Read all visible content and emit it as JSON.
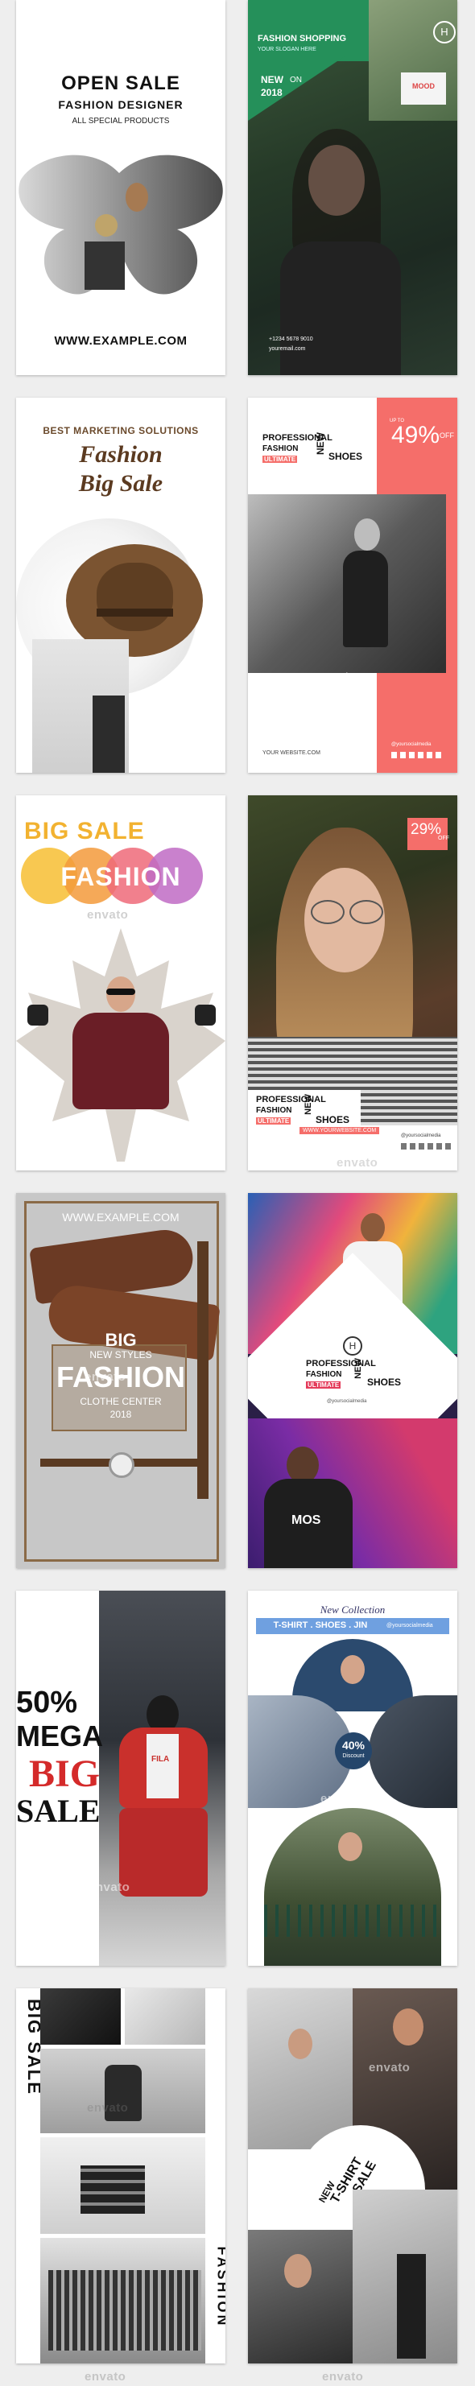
{
  "watermark": "envato",
  "t1": {
    "title": "OPEN SALE",
    "subtitle": "FASHION DESIGNER",
    "tagline": "ALL SPECIAL PRODUCTS",
    "url": "WWW.EXAMPLE.COM"
  },
  "t2": {
    "header": "FASHION SHOPPING",
    "slogan": "YOUR SLOGAN HERE",
    "new_label": "NEW",
    "on_label": "ON",
    "year": "2018",
    "logo": "H",
    "shirt_text": "MOOD",
    "contact1": "+1234 5678 9010",
    "contact2": "youremail.com"
  },
  "t3": {
    "header": "BEST MARKETING SOLUTIONS",
    "line1": "Fashion",
    "line2": "Big Sale"
  },
  "t4": {
    "professional": "PROFESSIONAL",
    "fashion": "FASHION",
    "ultimate": "ULTIMATE",
    "new_label": "NEW",
    "shoes": "SHOES",
    "upto": "UP TO",
    "percent": "49%",
    "off": "OFF",
    "website": "YOUR WEBSITE.COM",
    "social": "@yoursocialmedia"
  },
  "t5": {
    "big_sale": "BIG SALE",
    "fashion": "FASHION"
  },
  "t6": {
    "percent": "29%",
    "off": "OFF",
    "professional": "PROFESSIONAL",
    "fashion": "FASHION",
    "ultimate": "ULTIMATE",
    "new_label": "NEW",
    "shoes": "SHOES",
    "website": "WWW.YOURWEBSITE.COM",
    "social": "@yoursocialmedia"
  },
  "t7": {
    "url": "WWW.EXAMPLE.COM",
    "big": "BIG",
    "new_styles": "NEW STYLES",
    "fashion": "FASHION",
    "clothe_center": "CLOTHE CENTER",
    "year": "2018"
  },
  "t8": {
    "logo": "H",
    "professional": "PROFESSIONAL",
    "fashion": "FASHION",
    "ultimate": "ULTIMATE",
    "new_label": "NEW",
    "shoes": "SHOES",
    "social": "@yoursocialmedia",
    "shirt_text": "MOS"
  },
  "t9": {
    "percent": "50%",
    "mega": "MEGA",
    "big": "BIG",
    "sale": "SALE",
    "shirt_text": "FILA"
  },
  "t10": {
    "collection": "New Collection",
    "items": "T-SHIRT . SHOES . JIN",
    "social": "@yoursocialmedia",
    "percent": "40%",
    "discount": "Discount"
  },
  "t11": {
    "big_sale": "BIG SALE",
    "fashion": "FASHION"
  },
  "t12": {
    "line1": "T-SHIRT",
    "line2": "SALE",
    "line3": "NEW"
  }
}
